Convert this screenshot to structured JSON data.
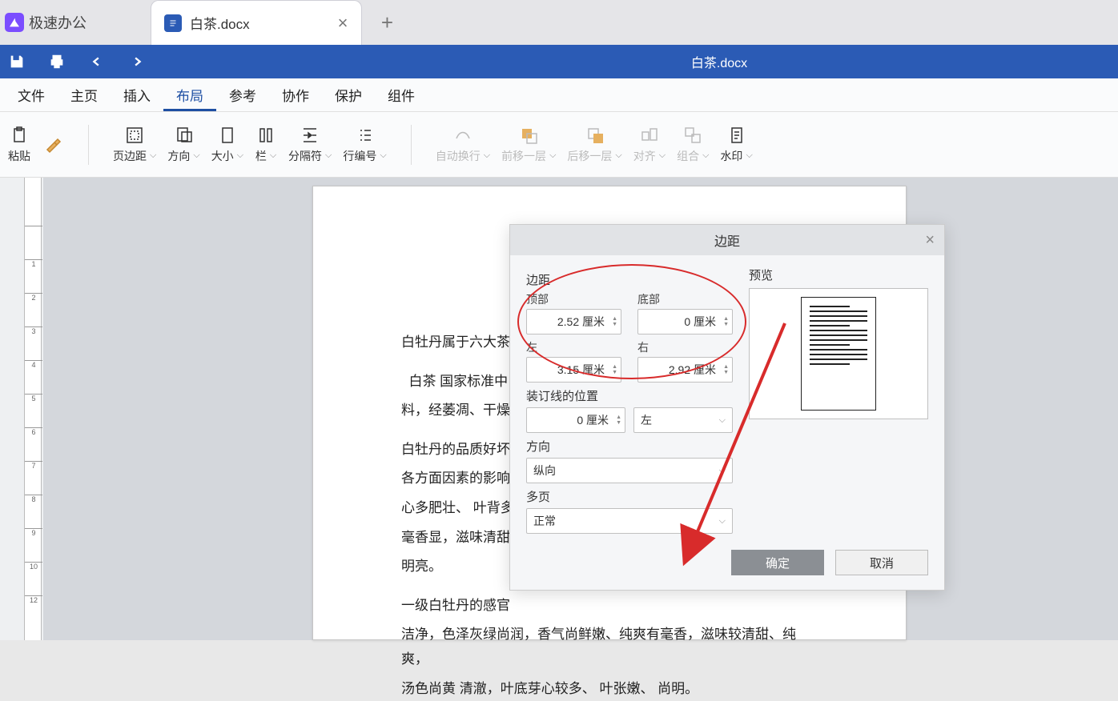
{
  "app": {
    "name": "极速办公"
  },
  "tab": {
    "name": "白茶.docx"
  },
  "title": "白茶.docx",
  "menu": {
    "file": "文件",
    "home": "主页",
    "insert": "插入",
    "layout": "布局",
    "reference": "参考",
    "cooperate": "协作",
    "protect": "保护",
    "plugin": "组件"
  },
  "ribbon": {
    "paste": "粘贴",
    "margins": "页边距",
    "orientation": "方向",
    "size": "大小",
    "columns": "栏",
    "breaks": "分隔符",
    "linenumbers": "行编号",
    "autowrap": "自动换行",
    "forward": "前移一层",
    "backward": "后移一层",
    "align": "对齐",
    "group": "组合",
    "watermark": "水印"
  },
  "doc": {
    "p1": "白牡丹属于六大茶",
    "p2": "白茶  国家标准中",
    "p3": "料，经萎凋、干燥",
    "p4": "白牡丹的品质好坏",
    "p5": "各方面因素的影响",
    "p6": "心多肥壮、  叶背多",
    "p7": "毫香显，滋味清甜",
    "p8": "明亮。",
    "p9": "一级白牡丹的感官",
    "p10": "洁净，色泽灰绿尚润，香气尚鲜嫩、纯爽有毫香，滋味较清甜、纯爽，",
    "p11": "汤色尚黄  清澈，叶底芽心较多、  叶张嫩、  尚明。"
  },
  "dialog": {
    "title": "边距",
    "margins_section": "边距",
    "top": "顶部",
    "bottom": "底部",
    "left": "左",
    "right": "右",
    "gutter_section": "装订线的位置",
    "orientation_section": "方向",
    "multi_section": "多页",
    "preview": "预览",
    "top_val": "2.52 厘米",
    "bottom_val": "0 厘米",
    "left_val": "3.15 厘米",
    "right_val": "2.92 厘米",
    "gutter_val": "0 厘米",
    "gutter_pos": "左",
    "orientation_val": "纵向",
    "multi_val": "正常",
    "ok": "确定",
    "cancel": "取消"
  }
}
